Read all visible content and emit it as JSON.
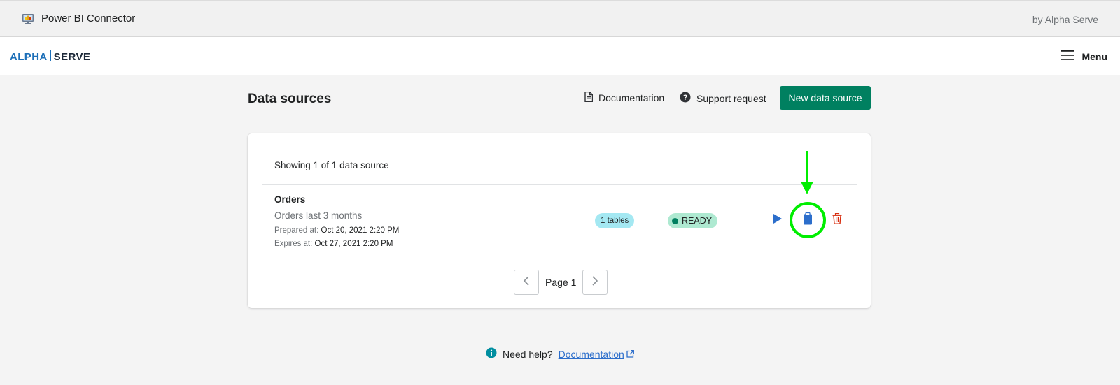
{
  "topbar": {
    "app_title": "Power BI Connector",
    "by_line": "by Alpha Serve"
  },
  "navbar": {
    "logo_left": "ALPHA",
    "logo_right": "SERVE",
    "menu_label": "Menu"
  },
  "page": {
    "title": "Data sources",
    "documentation_label": "Documentation",
    "support_label": "Support request",
    "new_button_label": "New data source"
  },
  "list": {
    "showing_text": "Showing 1 of 1 data source",
    "items": [
      {
        "name": "Orders",
        "description": "Orders last 3 months",
        "prepared_label": "Prepared at:",
        "prepared_value": "Oct 20, 2021 2:20 PM",
        "expires_label": "Expires at:",
        "expires_value": "Oct 27, 2021 2:20 PM",
        "tables_badge": "1 tables",
        "status": "READY"
      }
    ],
    "page_label": "Page 1"
  },
  "footer": {
    "help_text": "Need help?",
    "help_link": "Documentation"
  },
  "colors": {
    "primary": "#008060",
    "ready_badge": "#aee9d1",
    "tables_badge": "#a4e8f2",
    "link": "#2c6ecb",
    "highlight": "#00ee00",
    "delete": "#d72c0d"
  },
  "icons": {
    "app": "power-bi-icon",
    "menu": "hamburger-icon",
    "doc": "document-icon",
    "support": "question-circle-icon",
    "run": "play-icon",
    "copy": "clipboard-icon",
    "delete": "trash-icon",
    "prev": "chevron-left-icon",
    "next": "chevron-right-icon",
    "info": "info-icon",
    "external": "external-link-icon"
  }
}
